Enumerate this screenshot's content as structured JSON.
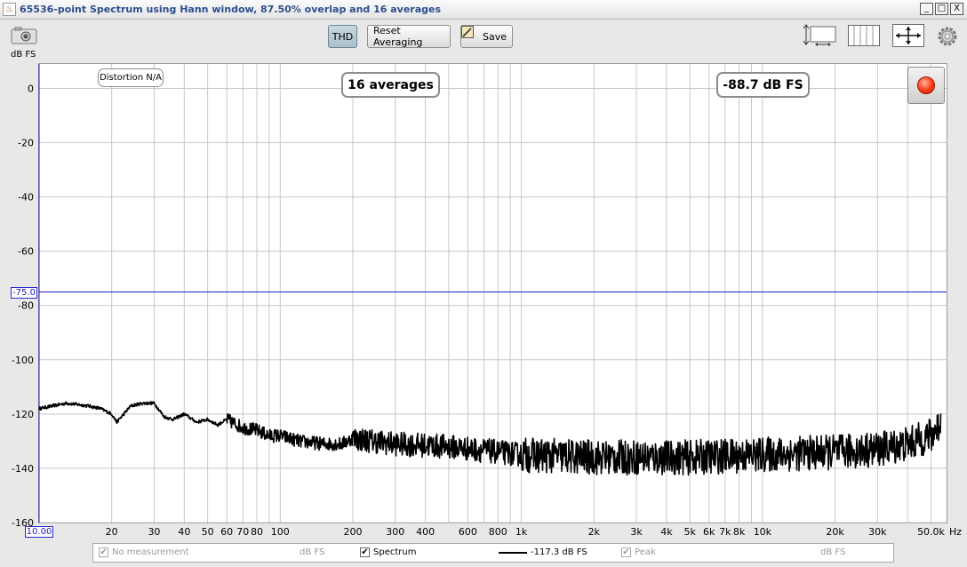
{
  "window": {
    "title": "65536-point Spectrum using Hann window, 87.50% overlap and 16 averages",
    "icon": "java-icon",
    "buttons": {
      "minimize": "_",
      "maximize": "□",
      "close": "X"
    }
  },
  "toolbar": {
    "snapshot_icon": "camera-icon",
    "thd_label": "THD",
    "reset_label": "Reset Averaging",
    "save_label": "Save",
    "right_icons": [
      "fit-height-icon",
      "grid-view-icon",
      "pan-arrows-icon",
      "settings-gear-icon"
    ]
  },
  "plot": {
    "units": "dB FS",
    "distortion_label": "Distortion N/A",
    "averages_label": "16 averages",
    "level_label": "-88.7 dB FS",
    "reference_level": "-75.0",
    "x_start_label": "10.00",
    "x_unit": "Hz",
    "record_icon": "record-icon"
  },
  "legend": {
    "no_measurement": {
      "label": "No measurement",
      "unit": "dB FS",
      "checked": true
    },
    "spectrum": {
      "label": "Spectrum",
      "value": "-117.3 dB FS",
      "checked": true
    },
    "peak": {
      "label": "Peak",
      "unit": "dB FS",
      "checked": true
    }
  },
  "colors": {
    "trace": "#000000",
    "reference_line": "#2020c0",
    "grid": "#c8c8c8",
    "record": "#ff3a12"
  },
  "chart_data": {
    "type": "line",
    "title": "",
    "xlabel": "Hz",
    "ylabel": "dB FS",
    "x_scale": "log",
    "xlim": [
      10,
      58000
    ],
    "ylim": [
      -160,
      9
    ],
    "y_ticks": [
      0,
      -20,
      -40,
      -60,
      -80,
      -100,
      -120,
      -140,
      -160
    ],
    "x_ticks": [
      {
        "value": 20,
        "label": "20"
      },
      {
        "value": 30,
        "label": "30"
      },
      {
        "value": 40,
        "label": "40"
      },
      {
        "value": 50,
        "label": "50"
      },
      {
        "value": 60,
        "label": "60"
      },
      {
        "value": 70,
        "label": "70"
      },
      {
        "value": 80,
        "label": "80"
      },
      {
        "value": 100,
        "label": "100"
      },
      {
        "value": 200,
        "label": "200"
      },
      {
        "value": 300,
        "label": "300"
      },
      {
        "value": 400,
        "label": "400"
      },
      {
        "value": 600,
        "label": "600"
      },
      {
        "value": 800,
        "label": "800"
      },
      {
        "value": 1000,
        "label": "1k"
      },
      {
        "value": 2000,
        "label": "2k"
      },
      {
        "value": 3000,
        "label": "3k"
      },
      {
        "value": 4000,
        "label": "4k"
      },
      {
        "value": 5000,
        "label": "5k"
      },
      {
        "value": 6000,
        "label": "6k"
      },
      {
        "value": 7000,
        "label": "7k"
      },
      {
        "value": 8000,
        "label": "8k"
      },
      {
        "value": 10000,
        "label": "10k"
      },
      {
        "value": 20000,
        "label": "20k"
      },
      {
        "value": 30000,
        "label": "30k"
      },
      {
        "value": 50000,
        "label": "50.0k"
      }
    ],
    "minor_x_ticks": [
      90,
      500,
      700,
      900,
      9000,
      40000
    ],
    "reference_line_db": -75,
    "grid": true,
    "series": [
      {
        "name": "Spectrum",
        "x": [
          10,
          13,
          16,
          18,
          20,
          21,
          24,
          27,
          30,
          33,
          36,
          40,
          45,
          50,
          55,
          60,
          70,
          80,
          90,
          100,
          120,
          150,
          180,
          200,
          300,
          500,
          800,
          1000,
          2000,
          3000,
          5000,
          10000,
          20000,
          30000,
          40000,
          50000,
          55000
        ],
        "y": [
          -118,
          -116,
          -117,
          -118,
          -120,
          -123,
          -117,
          -116,
          -116,
          -121,
          -122,
          -120,
          -123,
          -122,
          -124,
          -122,
          -125,
          -126,
          -128,
          -128,
          -130,
          -131,
          -131,
          -129,
          -131,
          -132,
          -134,
          -135,
          -136,
          -136,
          -136,
          -135,
          -134,
          -133,
          -131,
          -128,
          -123
        ]
      }
    ]
  }
}
